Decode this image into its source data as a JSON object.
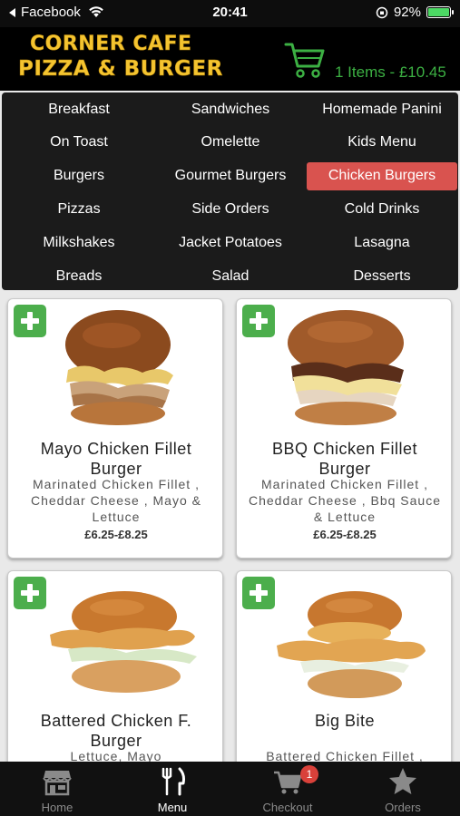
{
  "status_bar": {
    "back_app": "Facebook",
    "time": "20:41",
    "battery": "92%"
  },
  "header": {
    "logo_line1": "CORNER CAFE",
    "logo_line2": "PIZZA & BURGER",
    "cart_summary": "1 Items - £10.45"
  },
  "categories": [
    {
      "label": "Breakfast"
    },
    {
      "label": "Sandwiches"
    },
    {
      "label": "Homemade Panini"
    },
    {
      "label": "On Toast"
    },
    {
      "label": "Omelette"
    },
    {
      "label": "Kids Menu"
    },
    {
      "label": "Burgers"
    },
    {
      "label": "Gourmet Burgers"
    },
    {
      "label": "Chicken Burgers",
      "selected": true
    },
    {
      "label": "Pizzas"
    },
    {
      "label": "Side Orders"
    },
    {
      "label": "Cold Drinks"
    },
    {
      "label": "Milkshakes"
    },
    {
      "label": "Jacket Potatoes"
    },
    {
      "label": "Lasagna"
    },
    {
      "label": "Breads"
    },
    {
      "label": "Salad"
    },
    {
      "label": "Desserts"
    }
  ],
  "products": [
    {
      "name": "Mayo Chicken Fillet Burger",
      "description": "Marinated Chicken Fillet , Cheddar Cheese , Mayo & Lettuce",
      "price": "£6.25-£8.25"
    },
    {
      "name": "BBQ Chicken Fillet Burger",
      "description": "Marinated Chicken Fillet , Cheddar Cheese , Bbq Sauce & Lettuce",
      "price": "£6.25-£8.25"
    },
    {
      "name": "Battered Chicken F. Burger",
      "description": "Lettuce, Mayo"
    },
    {
      "name": "Big Bite",
      "description": "Battered Chicken Fillet ,"
    }
  ],
  "tab_bar": {
    "home": "Home",
    "menu": "Menu",
    "checkout": "Checkout",
    "orders": "Orders",
    "checkout_badge": "1"
  },
  "colors": {
    "accent_selected": "#d9534f",
    "add_button": "#4cae4c",
    "logo_gold": "#f4c430",
    "cart_green": "#3cb043",
    "badge_red": "#d9413a"
  },
  "icons": {
    "back": "back-arrow-icon",
    "wifi": "wifi-icon",
    "lock": "orientation-lock-icon",
    "cart": "shopping-cart-icon",
    "add": "plus-icon",
    "home": "store-icon",
    "menu": "fork-knife-icon",
    "checkout": "cart-icon",
    "orders": "star-icon"
  }
}
